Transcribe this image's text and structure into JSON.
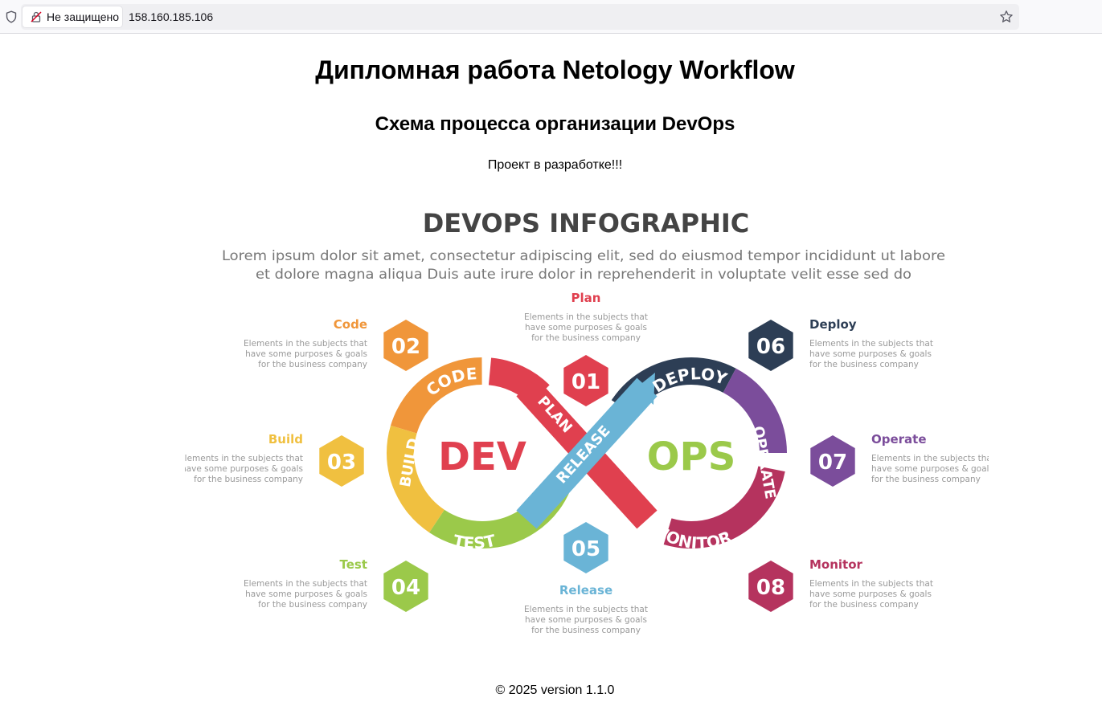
{
  "browser": {
    "security_label": "Не защищено",
    "url": "158.160.185.106"
  },
  "page": {
    "title": "Дипломная работа Netology Workflow",
    "subtitle": "Схема процесса организации DevOps",
    "status": "Проект в разработке!!!",
    "footer": "© 2025 version 1.1.0"
  },
  "infographic": {
    "heading": "DEVOPS INFOGRAPHIC",
    "intro_line1": "Lorem ipsum dolor sit amet, consectetur adipiscing elit, sed do eiusmod tempor incididunt ut labore",
    "intro_line2": "et dolore magna aliqua Duis aute irure dolor in reprehenderit in voluptate velit esse sed do",
    "dev_label": "DEV",
    "ops_label": "OPS",
    "desc_line1": "Elements in the subjects that",
    "desc_line2": "have  some purposes & goals",
    "desc_line3": "for the  business company",
    "ring_labels": {
      "plan": "PLAN",
      "code": "CODE",
      "build": "BUILD",
      "test": "TEST",
      "release": "RELEASE",
      "deploy": "DEPLOY",
      "operate": "OPERATE",
      "monitor": "MONITOR"
    },
    "steps": [
      {
        "number": "01",
        "name": "Plan",
        "color": "#e0404f"
      },
      {
        "number": "02",
        "name": "Code",
        "color": "#f0963a"
      },
      {
        "number": "03",
        "name": "Build",
        "color": "#f0c040"
      },
      {
        "number": "04",
        "name": "Test",
        "color": "#9bc94a"
      },
      {
        "number": "05",
        "name": "Release",
        "color": "#6ab4d6"
      },
      {
        "number": "06",
        "name": "Deploy",
        "color": "#2d3e55"
      },
      {
        "number": "07",
        "name": "Operate",
        "color": "#7b4d9b"
      },
      {
        "number": "08",
        "name": "Monitor",
        "color": "#b5335e"
      }
    ],
    "colors": {
      "dev": "#e0404f",
      "ops": "#9bc94a",
      "heading": "#444444",
      "body_text": "#888888"
    }
  }
}
